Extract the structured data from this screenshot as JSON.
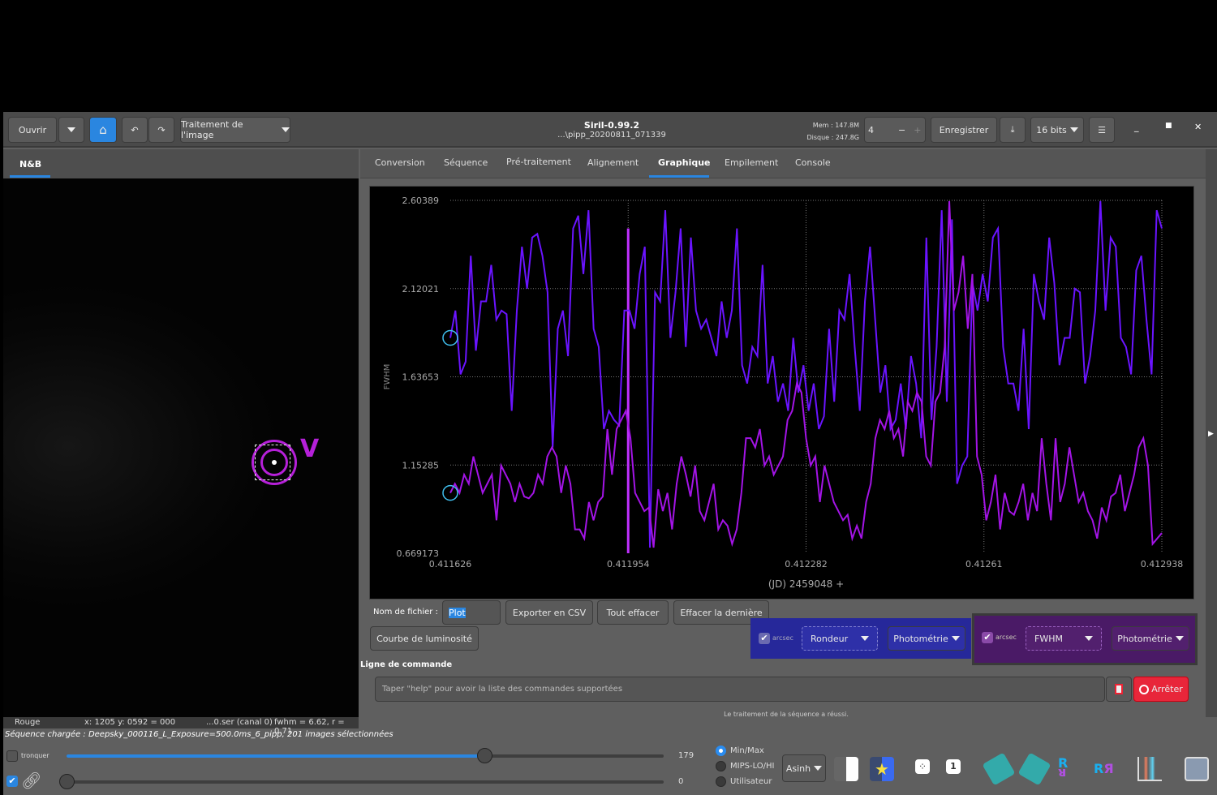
{
  "header": {
    "open": "Ouvrir",
    "processing": "Traitement de l'image",
    "title": "Siril-0.99.2",
    "subtitle": "...\\pipp_20200811_071339",
    "mem": "Mem : 147.8M",
    "disk": "Disque : 247.8G",
    "threads": "4",
    "save": "Enregistrer",
    "bits": "16 bits"
  },
  "left": {
    "tab": "N&B",
    "marker_label": "V",
    "status": {
      "channel": "Rouge",
      "coords": "x: 1205 y: 0592 = 000",
      "file": "...0.ser (canal 0)",
      "fwhm": "fwhm = 6.62, r = 0.71"
    }
  },
  "tabs": [
    "Conversion",
    "Séquence",
    "Pré-traitement",
    "Alignement",
    "Graphique",
    "Empilement",
    "Console"
  ],
  "active_tab": "Graphique",
  "plot_controls": {
    "filename_label": "Nom de fichier :",
    "filename_value": "Plot",
    "export_csv": "Exporter en CSV",
    "clear_all": "Tout effacer",
    "clear_last": "Effacer la dernière",
    "light_curve": "Courbe de luminosité",
    "left_group": {
      "arcsec": "arcsec",
      "metric": "Rondeur",
      "source": "Photométrie",
      "checked": true,
      "color": "#26289a"
    },
    "right_group": {
      "arcsec": "arcsec",
      "metric": "FWHM",
      "source": "Photométrie",
      "checked": true,
      "color": "#4a1a66"
    }
  },
  "command": {
    "label": "Ligne de commande",
    "placeholder": "Taper \"help\" pour avoir la liste des commandes supportées",
    "stop": "Arrêter",
    "status": "Le traitement de la séquence a réussi."
  },
  "sequence_status": "Séquence chargée : Deepsky_000116_L_Exposure=500.0ms_6_pipp, 201 images sélectionnées",
  "bottom": {
    "clip": "tronquer",
    "clip_checked": false,
    "link_checked": true,
    "high_value": "179",
    "low_value": "0",
    "high_fraction": 0.7,
    "low_fraction": 0.0,
    "modes": [
      "Min/Max",
      "MIPS-LO/HI",
      "Utilisateur"
    ],
    "selected_mode": "Min/Max",
    "stretch": "Asinh"
  },
  "chart_data": {
    "type": "line",
    "ylabel": "FWHM",
    "xlabel": "(JD) 2459048 +",
    "xlim": [
      0.411626,
      0.412938
    ],
    "ylim": [
      0.669173,
      2.60389
    ],
    "xticks": [
      "0.411626",
      "0.411954",
      "0.412282",
      "0.41261",
      "0.412938"
    ],
    "yticks": [
      "2.60389",
      "2.12021",
      "1.63653",
      "1.15285",
      "0.669173"
    ],
    "grid": true,
    "selected_x": 0.411954,
    "series": [
      {
        "color": "#6a14ff",
        "values": [
          1.85,
          2.0,
          1.65,
          1.72,
          2.3,
          1.78,
          2.05,
          2.05,
          2.25,
          1.95,
          2.0,
          1.98,
          1.45,
          2.0,
          2.35,
          2.12,
          2.4,
          2.42,
          2.3,
          2.1,
          1.25,
          1.9,
          2.0,
          1.75,
          2.45,
          2.52,
          2.2,
          2.55,
          1.9,
          1.8,
          1.35,
          1.45,
          1.4,
          1.37,
          2.0,
          2.0,
          1.9,
          2.2,
          2.35,
          0.7,
          2.1,
          2.05,
          2.55,
          1.85,
          2.1,
          2.45,
          1.8,
          2.4,
          2.0,
          1.9,
          1.95,
          1.85,
          1.75,
          2.05,
          1.85,
          2.0,
          2.45,
          1.7,
          1.6,
          1.8,
          1.75,
          2.25,
          1.6,
          1.75,
          1.5,
          1.6,
          1.45,
          1.85,
          1.55,
          1.7,
          1.45,
          1.6,
          1.35,
          1.42,
          1.9,
          1.5,
          2.0,
          1.95,
          2.2,
          1.8,
          1.45,
          2.05,
          2.35,
          1.95,
          1.55,
          1.7,
          1.35,
          1.4,
          1.6,
          1.35,
          1.75,
          1.6,
          1.3,
          2.4,
          1.4,
          1.8,
          2.55,
          1.5,
          2.5,
          1.05,
          1.15,
          1.2,
          2.15,
          2.0,
          2.2,
          2.05,
          2.4,
          2.45,
          1.8,
          1.6,
          1.6,
          1.45,
          1.9,
          1.35,
          2.2,
          2.05,
          1.95,
          2.4,
          2.15,
          1.7,
          1.85,
          1.85,
          2.12,
          2.1,
          1.6,
          1.75,
          2.0,
          2.6,
          2.0,
          2.4,
          2.35,
          1.85,
          1.8,
          1.65,
          2.22,
          2.3,
          1.95,
          1.65,
          2.55,
          2.45
        ]
      },
      {
        "color": "#a314e6",
        "values": [
          1.0,
          1.05,
          1.0,
          1.1,
          1.05,
          1.2,
          1.1,
          1.0,
          1.05,
          1.1,
          0.85,
          1.15,
          1.1,
          1.05,
          0.95,
          1.05,
          0.98,
          0.97,
          1.0,
          1.1,
          1.05,
          1.2,
          1.25,
          1.2,
          1.0,
          1.15,
          1.05,
          0.8,
          0.8,
          0.75,
          0.95,
          0.85,
          0.95,
          0.98,
          1.35,
          1.1,
          1.35,
          1.4,
          1.45,
          1.3,
          1.0,
          0.95,
          0.9,
          0.92,
          0.7,
          1.02,
          0.9,
          1.0,
          0.8,
          1.05,
          1.2,
          1.1,
          0.98,
          1.15,
          0.9,
          0.85,
          0.95,
          1.05,
          0.8,
          0.85,
          0.82,
          0.72,
          0.8,
          1.0,
          1.3,
          1.3,
          1.25,
          1.35,
          1.15,
          1.2,
          1.1,
          1.15,
          1.2,
          1.4,
          1.45,
          1.6,
          1.55,
          1.3,
          1.15,
          1.2,
          0.95,
          1.15,
          1.05,
          0.95,
          0.9,
          0.85,
          0.88,
          0.75,
          0.82,
          0.75,
          0.95,
          1.05,
          1.3,
          1.4,
          1.35,
          1.45,
          1.3,
          1.35,
          1.2,
          1.5,
          1.45,
          1.55,
          1.5,
          1.2,
          1.15,
          1.5,
          1.55,
          1.8,
          2.6,
          2.0,
          2.1,
          2.3,
          1.9,
          2.2,
          1.2,
          1.1,
          0.85,
          0.95,
          1.1,
          0.8,
          1.0,
          0.9,
          0.88,
          0.95,
          1.05,
          0.85,
          1.0,
          0.9,
          1.3,
          1.05,
          0.85,
          1.3,
          0.95,
          1.05,
          1.25,
          1.1,
          0.95,
          1.0,
          0.9,
          0.85,
          0.75,
          0.92,
          0.85,
          0.98,
          1.0,
          1.1,
          0.9,
          1.0,
          1.1,
          1.25,
          1.3,
          1.15,
          0.72,
          0.75,
          0.78
        ]
      }
    ]
  }
}
